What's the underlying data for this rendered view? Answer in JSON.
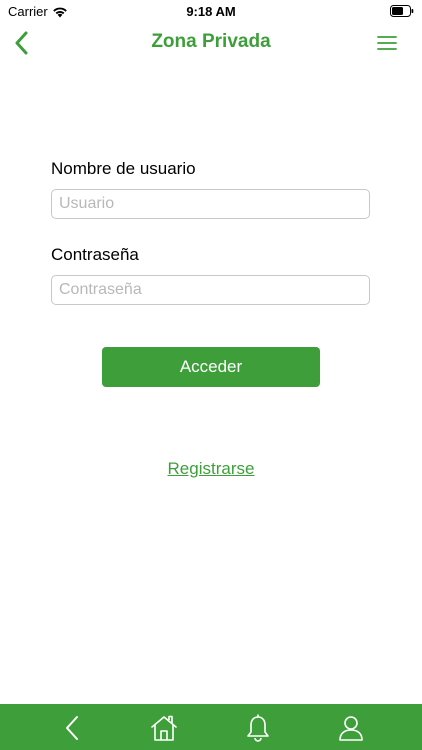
{
  "status_bar": {
    "carrier": "Carrier",
    "time": "9:18 AM"
  },
  "nav": {
    "title": "Zona Privada",
    "back_icon": "chevron-left-icon",
    "menu_icon": "hamburger-menu-icon"
  },
  "form": {
    "username_label": "Nombre de usuario",
    "username_placeholder": "Usuario",
    "username_value": "",
    "password_label": "Contraseña",
    "password_placeholder": "Contraseña",
    "password_value": "",
    "submit_label": "Acceder"
  },
  "register_link": "Registrarse",
  "tab_bar": {
    "items": [
      {
        "icon": "back-arrow-icon"
      },
      {
        "icon": "home-icon"
      },
      {
        "icon": "bell-icon"
      },
      {
        "icon": "user-icon"
      }
    ]
  },
  "colors": {
    "accent": "#3e9f3a",
    "input_border": "#c8c8c8",
    "placeholder": "#b8b8b8"
  }
}
